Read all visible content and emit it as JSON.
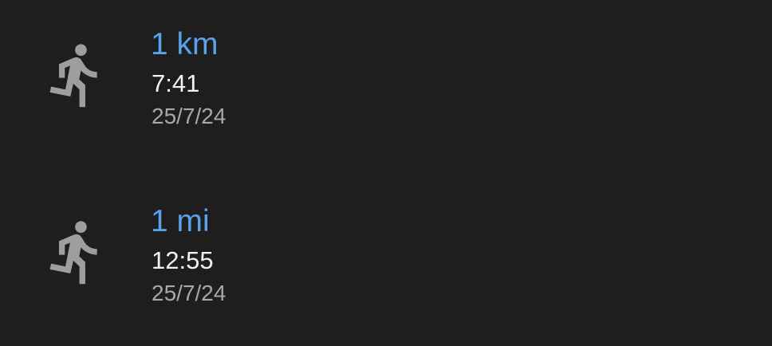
{
  "records": [
    {
      "icon": "running-person-icon",
      "distance": "1 km",
      "time": "7:41",
      "date": "25/7/24"
    },
    {
      "icon": "running-person-icon",
      "distance": "1 mi",
      "time": "12:55",
      "date": "25/7/24"
    }
  ],
  "colors": {
    "background": "#1e1e1e",
    "distance_accent": "#5aa2ec",
    "time_text": "#f2f2f2",
    "date_text": "#a8a8a8",
    "icon": "#9e9e9e"
  }
}
